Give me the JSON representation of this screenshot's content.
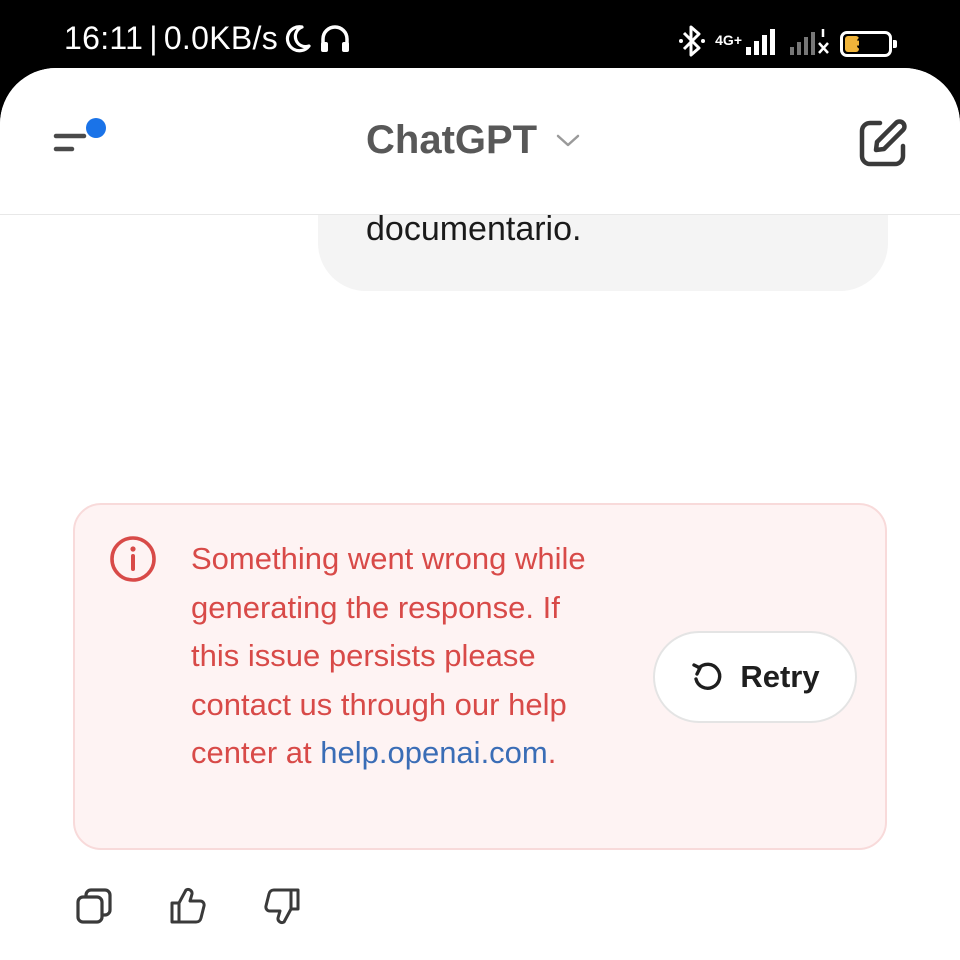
{
  "status_bar": {
    "time": "16:11",
    "separator": "|",
    "net_speed": "0.0KB/s",
    "network_type": "4G+",
    "battery_level": "33",
    "battery_fraction": 0.33,
    "battery_color": "#f0b43a",
    "icons": [
      "moon-icon",
      "headset-icon",
      "bluetooth-icon",
      "signal-icon",
      "signal-no-service-icon",
      "battery-icon"
    ]
  },
  "header": {
    "title": "ChatGPT",
    "menu_icon": "sidebar-menu-icon",
    "notification_dot_color": "#1a73e8",
    "dropdown_icon": "chevron-down-icon",
    "compose_icon": "new-chat-icon"
  },
  "conversation": {
    "user_message_visible_text": "documentario."
  },
  "error": {
    "message": "Something went wrong while generating the response. If this issue persists please contact us through our help center at ",
    "link_text": "help.openai.com",
    "trailing": ".",
    "retry_label": "Retry",
    "text_color": "#d84a48",
    "link_color": "#3a6db6",
    "background": "#fef3f3"
  },
  "message_actions": {
    "icons": [
      "copy-icon",
      "thumbs-up-icon",
      "thumbs-down-icon"
    ]
  }
}
